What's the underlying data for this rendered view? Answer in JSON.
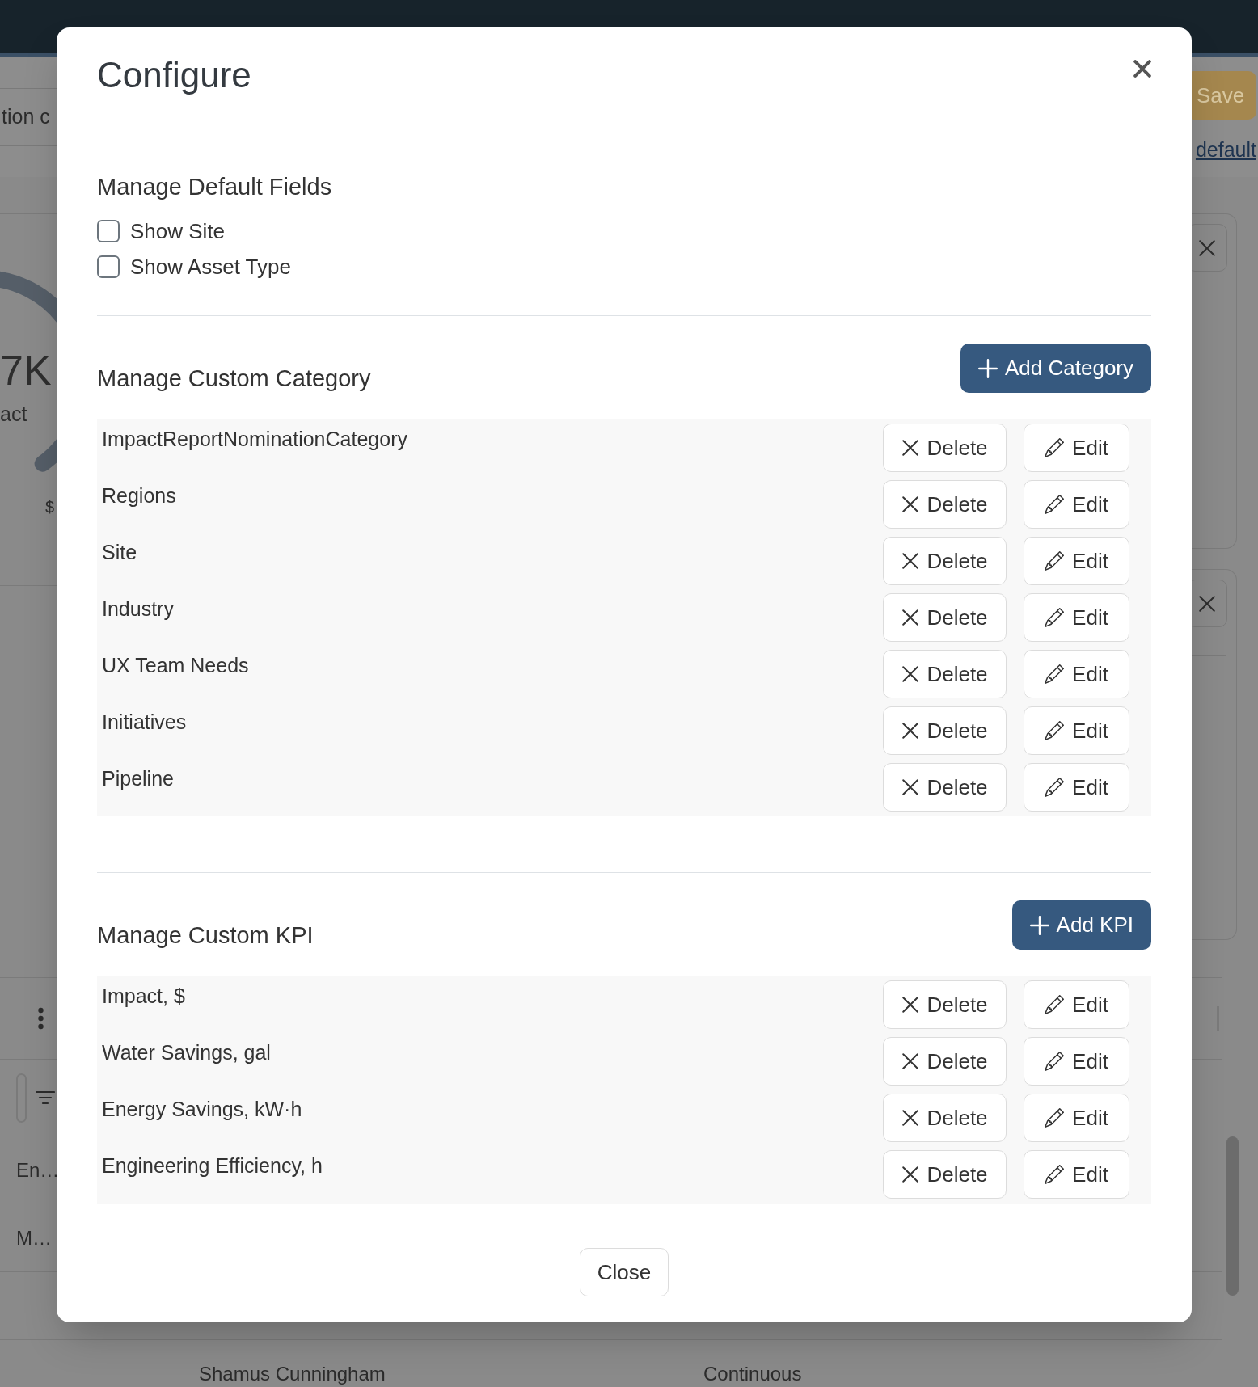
{
  "background": {
    "header": {
      "tab_text": "tion c",
      "save_button": "Save",
      "link": "default"
    },
    "gauge": {
      "value": "7K",
      "label": "act",
      "axis_label": "$"
    },
    "table": {
      "rows": [
        {
          "kind": "text",
          "column_1": "En…"
        },
        {
          "kind": "text",
          "column_1": "M…"
        },
        {
          "kind": "blank"
        },
        {
          "kind": "text",
          "column_2": "Shamus Cunningham",
          "column_3": "Continuous"
        }
      ]
    }
  },
  "modal": {
    "title": "Configure",
    "default_fields": {
      "title": "Manage Default Fields",
      "options": [
        {
          "label": "Show Site",
          "checked": false
        },
        {
          "label": "Show Asset Type",
          "checked": false
        }
      ]
    },
    "sections": [
      {
        "title": "Manage Custom Category",
        "add_button": "Add Category",
        "items": [
          {
            "name": "ImpactReportNominationCategory",
            "delete_button": "Delete",
            "edit_button": "Edit"
          },
          {
            "name": "Regions",
            "delete_button": "Delete",
            "edit_button": "Edit"
          },
          {
            "name": "Site",
            "delete_button": "Delete",
            "edit_button": "Edit"
          },
          {
            "name": "Industry",
            "delete_button": "Delete",
            "edit_button": "Edit"
          },
          {
            "name": "UX Team Needs",
            "delete_button": "Delete",
            "edit_button": "Edit"
          },
          {
            "name": "Initiatives",
            "delete_button": "Delete",
            "edit_button": "Edit"
          },
          {
            "name": "Pipeline",
            "delete_button": "Delete",
            "edit_button": "Edit"
          }
        ]
      },
      {
        "title": "Manage Custom KPI",
        "add_button": "Add KPI",
        "items": [
          {
            "name": "Impact, $",
            "delete_button": "Delete",
            "edit_button": "Edit"
          },
          {
            "name": "Water Savings, gal",
            "delete_button": "Delete",
            "edit_button": "Edit"
          },
          {
            "name": "Energy Savings, kW·h",
            "delete_button": "Delete",
            "edit_button": "Edit"
          },
          {
            "name": "Engineering Efficiency, h",
            "delete_button": "Delete",
            "edit_button": "Edit"
          }
        ]
      }
    ],
    "close_button": "Close"
  }
}
